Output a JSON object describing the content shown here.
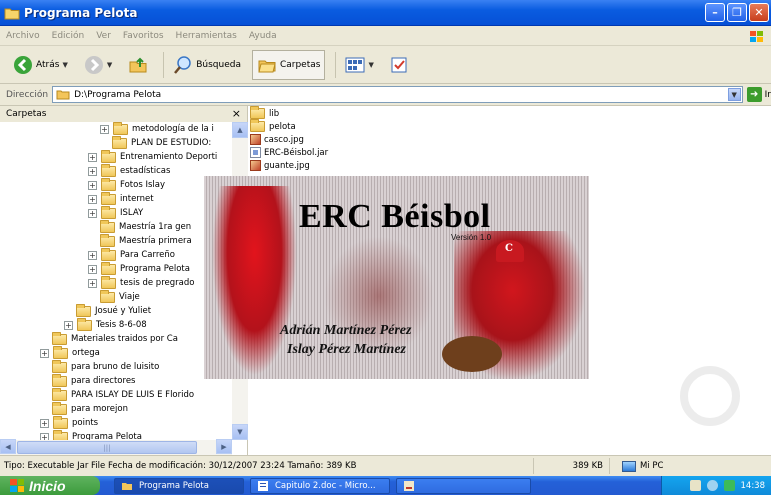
{
  "window": {
    "title": "Programa Pelota"
  },
  "menu": [
    "Archivo",
    "Edición",
    "Ver",
    "Favoritos",
    "Herramientas",
    "Ayuda"
  ],
  "toolbar": {
    "back": "Atrás",
    "search": "Búsqueda",
    "folders": "Carpetas"
  },
  "address": {
    "label": "Dirección",
    "path": "D:\\Programa Pelota",
    "go": "Ir"
  },
  "folders_pane": {
    "title": "Carpetas",
    "close": "×",
    "tree": [
      {
        "label": "metodología de la i",
        "indent": 8,
        "expander": "+"
      },
      {
        "label": "PLAN DE ESTUDIO:",
        "indent": 9,
        "expander": ""
      },
      {
        "label": "Entrenamiento Deporti",
        "indent": 7,
        "expander": "+"
      },
      {
        "label": "estadísticas",
        "indent": 7,
        "expander": "+"
      },
      {
        "label": "Fotos Islay",
        "indent": 7,
        "expander": "+"
      },
      {
        "label": "internet",
        "indent": 7,
        "expander": "+"
      },
      {
        "label": "ISLAY",
        "indent": 7,
        "expander": "+"
      },
      {
        "label": "Maestría 1ra gen",
        "indent": 8,
        "expander": ""
      },
      {
        "label": "Maestría primera",
        "indent": 8,
        "expander": ""
      },
      {
        "label": "Para Carreño",
        "indent": 7,
        "expander": "+"
      },
      {
        "label": "Programa Pelota",
        "indent": 7,
        "expander": "+"
      },
      {
        "label": "tesis de pregrado",
        "indent": 7,
        "expander": "+"
      },
      {
        "label": "Viaje",
        "indent": 8,
        "expander": ""
      },
      {
        "label": "Josué y Yuliet",
        "indent": 6,
        "expander": ""
      },
      {
        "label": "Tesis 8-6-08",
        "indent": 5,
        "expander": "+"
      },
      {
        "label": "Materiales traidos por Ca",
        "indent": 4,
        "expander": ""
      },
      {
        "label": "ortega",
        "indent": 3,
        "expander": "+"
      },
      {
        "label": "para bruno de luisito",
        "indent": 4,
        "expander": ""
      },
      {
        "label": "para directores",
        "indent": 4,
        "expander": ""
      },
      {
        "label": "PARA ISLAY DE LUIS E Florido",
        "indent": 4,
        "expander": ""
      },
      {
        "label": "para morejon",
        "indent": 4,
        "expander": ""
      },
      {
        "label": "points",
        "indent": 3,
        "expander": "+"
      },
      {
        "label": "Programa Pelota",
        "indent": 3,
        "expander": "+"
      }
    ]
  },
  "files": [
    {
      "name": "lib",
      "type": "folder"
    },
    {
      "name": "pelota",
      "type": "folder"
    },
    {
      "name": "casco.jpg",
      "type": "jpg"
    },
    {
      "name": "ERC-Béisbol.jar",
      "type": "jar"
    },
    {
      "name": "guante.jpg",
      "type": "jpg"
    }
  ],
  "splash": {
    "title": "ERC Béisbol",
    "version": "Versión 1.0",
    "authors": [
      "Adrián Martínez Pérez",
      "Islay Pérez Martínez"
    ],
    "helmet_letter": "C"
  },
  "status": {
    "info": "Tipo: Executable Jar File Fecha de modificación: 30/12/2007 23:24 Tamaño: 389 KB",
    "size": "389 KB",
    "location": "Mi PC"
  },
  "taskbar": {
    "start": "Inicio",
    "tasks": [
      "Programa Pelota",
      "Capitulo 2.doc - Micro...",
      ""
    ],
    "clock": "14:38"
  },
  "colors": {
    "titlebar": "#0a5ce0",
    "start": "#3c9b3c",
    "taskbar": "#245dd7",
    "tray": "#0f8ad9"
  }
}
